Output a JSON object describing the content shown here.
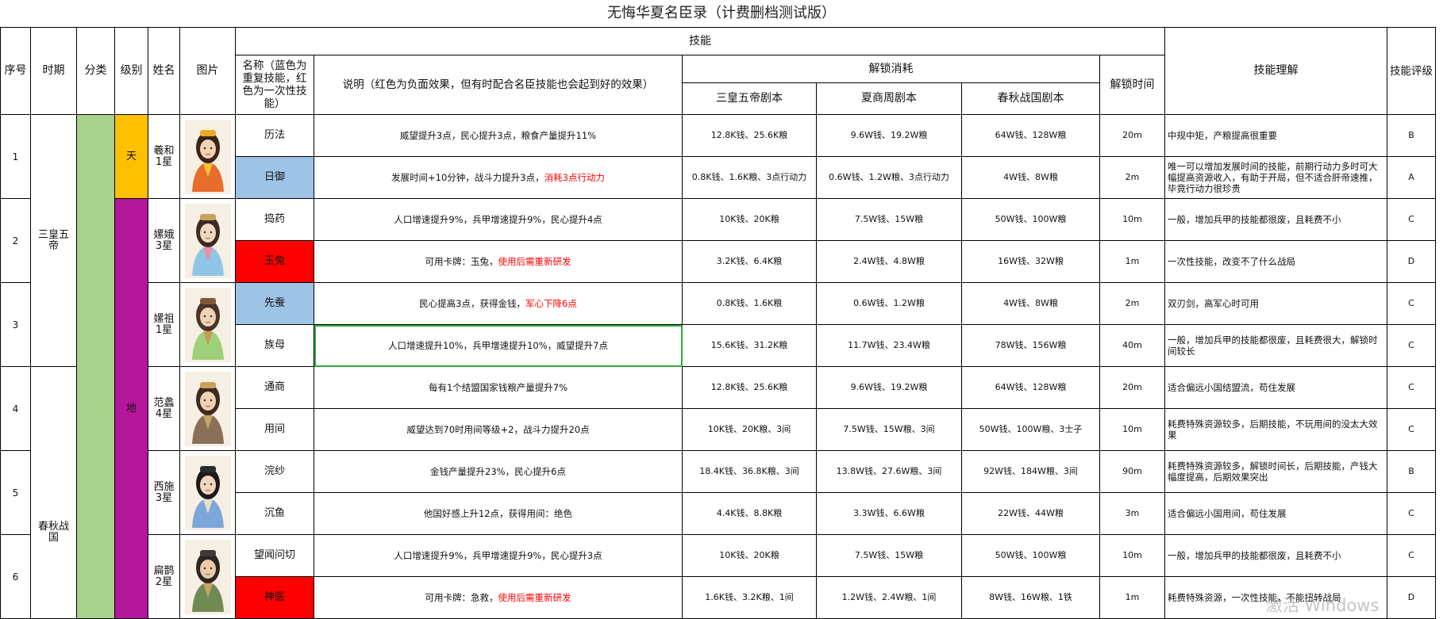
{
  "title": "无悔华夏名臣录（计费删档测试版）",
  "headers": {
    "index": "序号",
    "period": "时期",
    "category": "分类",
    "level": "级别",
    "name": "姓名",
    "image": "图片",
    "skills": "技能",
    "skill_name": "名称（蓝色为重复技能，红色为一次性技能）",
    "desc": "说明（红色为负面效果，但有时配合名臣技能也会起到好的效果）",
    "unlock_cost": "解锁消耗",
    "s1": "三皇五帝剧本",
    "s2": "夏商周剧本",
    "s3": "春秋战国剧本",
    "unlock_time": "解锁时间",
    "understand": "技能理解",
    "rating": "技能评级"
  },
  "periods": [
    "三皇五帝",
    "春秋战国"
  ],
  "levels": [
    "天",
    "地"
  ],
  "officials": [
    {
      "index": "1",
      "name": "羲和",
      "stars": "1星"
    },
    {
      "index": "2",
      "name": "嫘娥",
      "stars": "3星"
    },
    {
      "index": "3",
      "name": "嫘祖",
      "stars": "1星"
    },
    {
      "index": "4",
      "name": "范蠡",
      "stars": "4星"
    },
    {
      "index": "5",
      "name": "西施",
      "stars": "3星"
    },
    {
      "index": "6",
      "name": "扁鹊",
      "stars": "2星"
    }
  ],
  "skills": [
    {
      "name": "历法",
      "desc": "威望提升3点，民心提升3点，粮食产量提升11%",
      "desc_red": "",
      "s1": "12.8K钱、25.6K粮",
      "s2": "9.6W钱、19.2W粮",
      "s3": "64W钱、128W粮",
      "time": "20m",
      "understand": "中规中矩，产粮提高很重要",
      "rating": "B",
      "color": ""
    },
    {
      "name": "日御",
      "desc": "发展时间+10分钟，战斗力提升3点，",
      "desc_red": "消耗3点行动力",
      "s1": "0.8K钱、1.6K粮、3点行动力",
      "s2": "0.6W钱、1.2W粮、3点行动力",
      "s3": "4W钱、8W粮",
      "time": "2m",
      "understand": "唯一可以增加发展时间的技能，前期行动力多时可大幅提高资源收入，有助于开局，但不适合肝帝速推，毕竟行动力很珍贵",
      "rating": "A",
      "color": "blue"
    },
    {
      "name": "捣药",
      "desc": "人口增速提升9%，兵甲增速提升9%，民心提升4点",
      "desc_red": "",
      "s1": "10K钱、20K粮",
      "s2": "7.5W钱、15W粮",
      "s3": "50W钱、100W粮",
      "time": "10m",
      "understand": "一般，增加兵甲的技能都很废，且耗费不小",
      "rating": "C",
      "color": ""
    },
    {
      "name": "玉兔",
      "desc": "可用卡牌：玉兔，",
      "desc_red": "使用后需重新研发",
      "s1": "3.2K钱、6.4K粮",
      "s2": "2.4W钱、4.8W粮",
      "s3": "16W钱、32W粮",
      "time": "1m",
      "understand": "一次性技能，改变不了什么战局",
      "rating": "D",
      "color": "red"
    },
    {
      "name": "先蚕",
      "desc": "民心提高3点，获得金钱，",
      "desc_red": "军心下降6点",
      "s1": "0.8K钱、1.6K粮",
      "s2": "0.6W钱、1.2W粮",
      "s3": "4W钱、8W粮",
      "time": "2m",
      "understand": "双刃剑，高军心时可用",
      "rating": "C",
      "color": "blue"
    },
    {
      "name": "族母",
      "desc": "人口增速提升10%，兵甲增速提升10%，威望提升7点",
      "desc_red": "",
      "s1": "15.6K钱、31.2K粮",
      "s2": "11.7W钱、23.4W粮",
      "s3": "78W钱、156W粮",
      "time": "40m",
      "understand": "一般，增加兵甲的技能都很废，且耗费很大，解锁时间较长",
      "rating": "C",
      "color": ""
    },
    {
      "name": "通商",
      "desc": "每有1个结盟国家钱粮产量提升7%",
      "desc_red": "",
      "s1": "12.8K钱、25.6K粮",
      "s2": "9.6W钱、19.2W粮",
      "s3": "64W钱、128W粮",
      "time": "20m",
      "understand": "适合偏远小国结盟流，苟住发展",
      "rating": "C",
      "color": ""
    },
    {
      "name": "用间",
      "desc": "威望达到70时用间等级+2，战斗力提升20点",
      "desc_red": "",
      "s1": "10K钱、20K粮、3间",
      "s2": "7.5W钱、15W粮、3间",
      "s3": "50W钱、100W粮、3士子",
      "time": "10m",
      "understand": "耗费特殊资源较多，后期技能，不玩用间的没太大效果",
      "rating": "C",
      "color": ""
    },
    {
      "name": "浣纱",
      "desc": "金钱产量提升23%，民心提升6点",
      "desc_red": "",
      "s1": "18.4K钱、36.8K粮、3间",
      "s2": "13.8W钱、27.6W粮、3间",
      "s3": "92W钱、184W粮、3间",
      "time": "90m",
      "understand": "耗费特殊资源较多，解锁时间长，后期技能，产钱大幅度提高，后期效果突出",
      "rating": "B",
      "color": ""
    },
    {
      "name": "沉鱼",
      "desc": "他国好感上升12点，获得用间：绝色",
      "desc_red": "",
      "s1": "4.4K钱、8.8K粮",
      "s2": "3.3W钱、6.6W粮",
      "s3": "22W钱、44W粮",
      "time": "3m",
      "understand": "适合偏远小国用间，苟住发展",
      "rating": "C",
      "color": ""
    },
    {
      "name": "望闻问切",
      "desc": "人口增速提升9%，兵甲增速提升9%，民心提升3点",
      "desc_red": "",
      "s1": "10K钱、20K粮",
      "s2": "7.5W钱、15W粮",
      "s3": "50W钱、100W粮",
      "time": "10m",
      "understand": "一般，增加兵甲的技能都很废，且耗费不小",
      "rating": "C",
      "color": ""
    },
    {
      "name": "神医",
      "desc": "可用卡牌：急救，",
      "desc_red": "使用后需重新研发",
      "s1": "1.6K钱、3.2K粮、1间",
      "s2": "1.2W钱、2.4W粮、1间",
      "s3": "8W钱、16W粮、1铁",
      "time": "1m",
      "understand": "耗费特殊资源，一次性技能，不能扭转战局",
      "rating": "D",
      "color": "red"
    }
  ],
  "watermark": "激活 Windows",
  "colors": {
    "blue": "#9dc3e6",
    "red": "#ff0000",
    "green": "#a9d18e",
    "gold": "#ffc000",
    "purple": "#b4169c"
  }
}
